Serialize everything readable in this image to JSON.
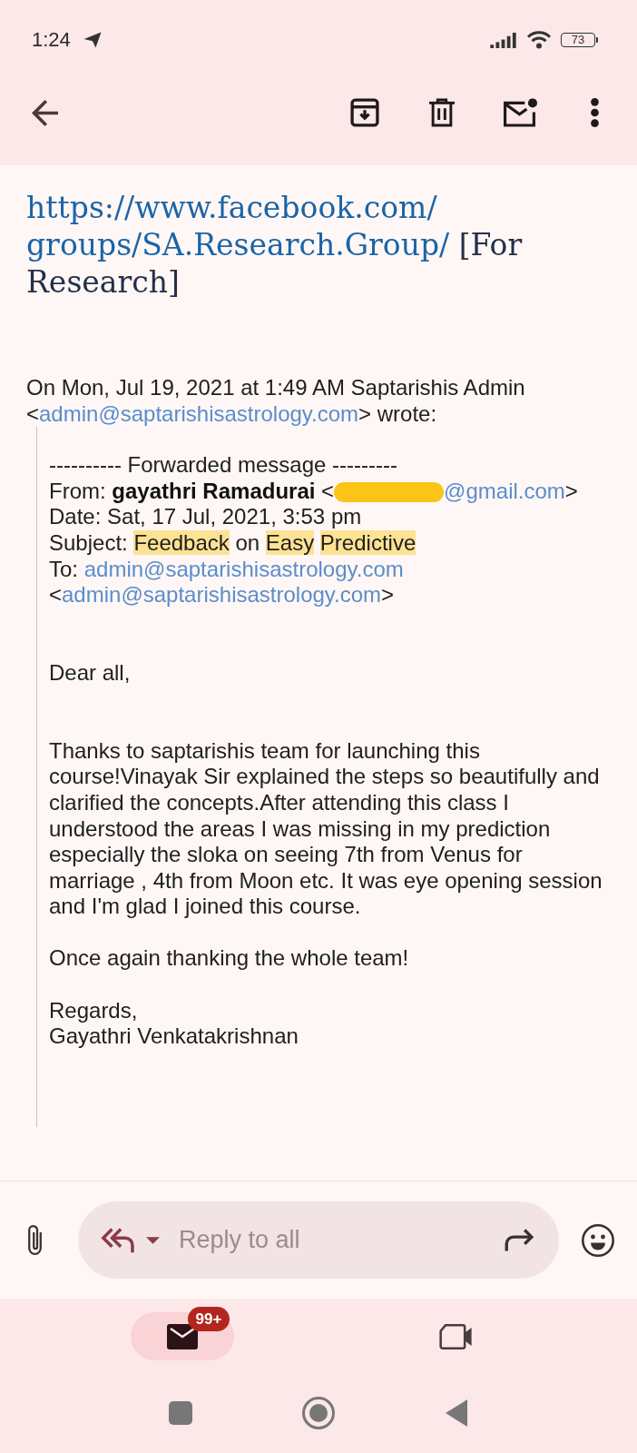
{
  "status_bar": {
    "time": "1:24",
    "battery": "73"
  },
  "message": {
    "link_block": {
      "url_lines": [
        "https://www.facebook.com/",
        "groups/SA.Research.Group/"
      ],
      "note": "[For Research]"
    },
    "attribution": [
      {
        "kind": "text",
        "text": "On Mon, Jul 19, 2021 at 1:49 AM Saptarishis Admin <"
      },
      {
        "kind": "link",
        "text": "admin@saptarishisastrology.com"
      },
      {
        "kind": "text",
        "text": "> wrote:"
      }
    ],
    "quote": {
      "header_lines": [
        [
          {
            "kind": "text",
            "text": "---------- Forwarded message ---------"
          }
        ],
        [
          {
            "kind": "text",
            "text": "From: **gayathri Ramadurai** <"
          },
          {
            "kind": "redaction"
          },
          {
            "kind": "link",
            "text": "@gmail.com"
          },
          {
            "kind": "text",
            "text": ">"
          }
        ],
        [
          {
            "kind": "text",
            "text": "Date: Sat, 17 Jul, 2021, 3:53 pm"
          }
        ],
        [
          {
            "kind": "text",
            "text": "Subject: "
          },
          {
            "kind": "highlight",
            "text": "Feedback"
          },
          {
            "kind": "text",
            "text": " on "
          },
          {
            "kind": "highlight",
            "text": "Easy"
          },
          {
            "kind": "highlight",
            "text": "Predictive"
          }
        ],
        [
          {
            "kind": "text",
            "text": "To: "
          },
          {
            "kind": "link",
            "text": "admin@saptarishisastrology.com"
          },
          {
            "kind": "text",
            "text": " <"
          },
          {
            "kind": "link",
            "text": "admin@saptarishisastrology.com"
          },
          {
            "kind": "text",
            "text": ">"
          }
        ]
      ],
      "body": [
        [
          "Dear all,"
        ],
        [
          "Thanks to saptarishis team for launching this course!Vinayak Sir explained the steps so beautifully and clarified the concepts.After attending this class I understood the areas I was missing in my prediction especially the sloka on seeing 7th from Venus for marriage , 4th from Moon etc. It was eye opening session and I'm glad I joined this course."
        ],
        [
          "Once again thanking the whole team!"
        ],
        [
          "Regards,",
          "Gayathri Venkatakrishnan"
        ]
      ]
    }
  },
  "reply_bar": {
    "placeholder": "Reply to all"
  },
  "bottom_nav": {
    "tabs": [
      {
        "kind": "mail",
        "selected": true,
        "badge": "99+"
      },
      {
        "kind": "video",
        "selected": false
      }
    ]
  }
}
